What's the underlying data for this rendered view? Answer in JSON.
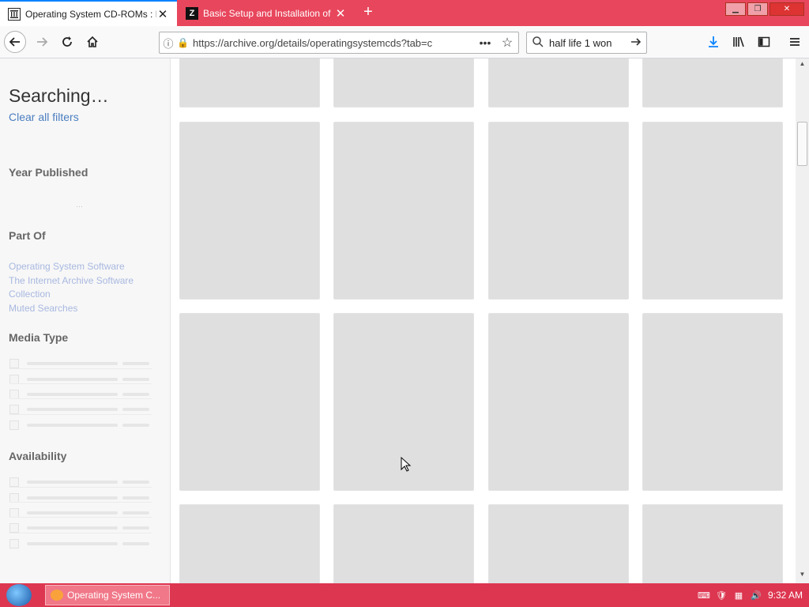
{
  "tabs": [
    {
      "title": "Operating System CD-ROMs : Fr",
      "icon": "archive-icon"
    },
    {
      "title": "Basic Setup and Installation of",
      "icon": "zdnet-icon"
    }
  ],
  "nav": {
    "url": "https://archive.org/details/operatingsystemcds?tab=c",
    "search_value": "half life 1 won"
  },
  "sidebar": {
    "status": "Searching…",
    "clear_filters": "Clear all filters",
    "year_heading": "Year Published",
    "part_of_heading": "Part Of",
    "part_of_links": [
      "Operating System Software",
      "The Internet Archive Software Collection",
      "Muted Searches"
    ],
    "media_type_heading": "Media Type",
    "availability_heading": "Availability"
  },
  "taskbar": {
    "task_label": "Operating System C...",
    "clock": "9:32 AM"
  },
  "colors": {
    "tabbar": "#e8465c",
    "taskbar": "#dd3650",
    "link": "#4a7ec0",
    "placeholder": "#dfdfdf"
  }
}
